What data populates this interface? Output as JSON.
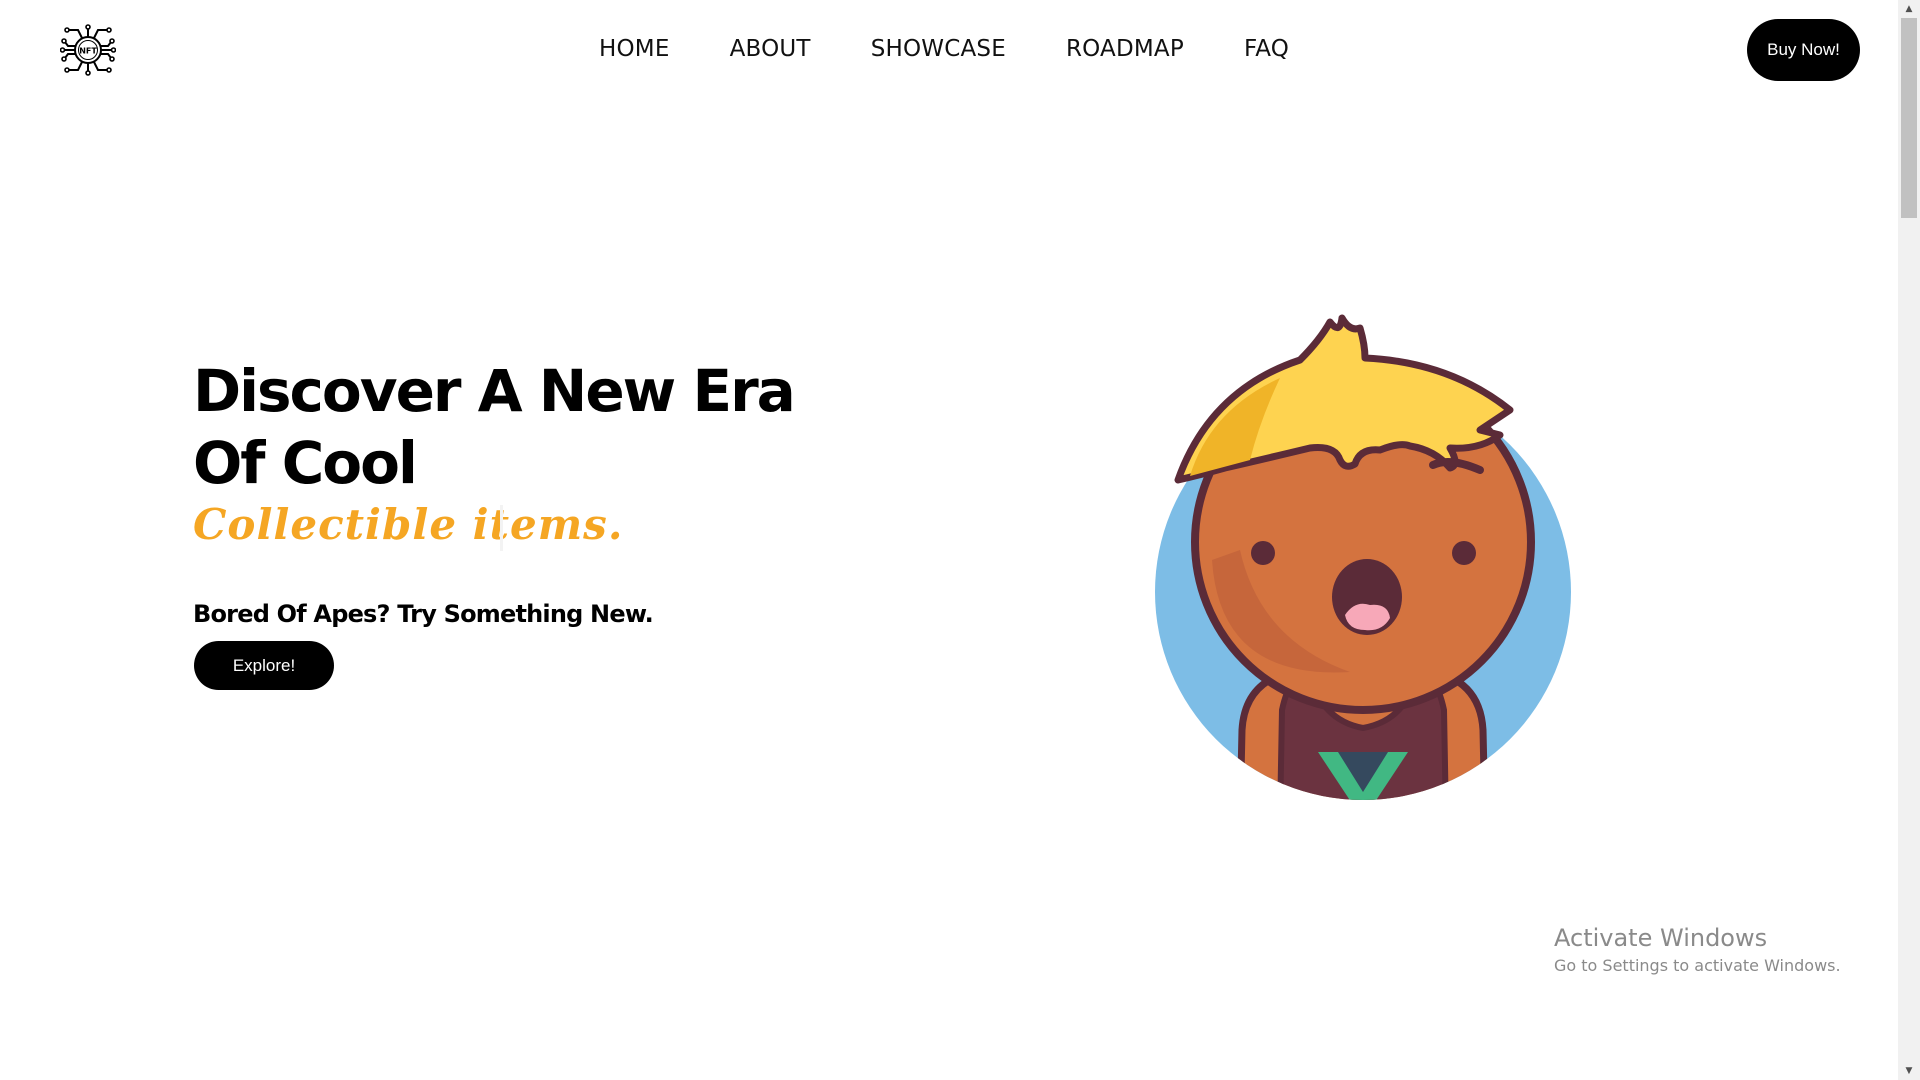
{
  "header": {
    "logo_text": "NFT",
    "nav": [
      {
        "label": "HOME"
      },
      {
        "label": "ABOUT"
      },
      {
        "label": "SHOWCASE"
      },
      {
        "label": "ROADMAP"
      },
      {
        "label": "FAQ"
      }
    ],
    "buy_label": "Buy Now!"
  },
  "hero": {
    "title": "Discover A New Era Of Cool",
    "subtitle": "Collectible items.",
    "tagline": "Bored Of Apes? Try Something New.",
    "explore_label": "Explore!"
  },
  "watermark": {
    "title": "Activate Windows",
    "subtitle": "Go to Settings to activate Windows."
  },
  "colors": {
    "accent": "#f5a623",
    "button_bg": "#000000",
    "avatar_circle": "#7dbde6",
    "hair": "#fed350",
    "skin": "#d4733f",
    "outline": "#5b2b38"
  },
  "icons": {
    "logo": "nft-circuit-logo-icon",
    "avatar": "nft-avatar-illustration"
  }
}
